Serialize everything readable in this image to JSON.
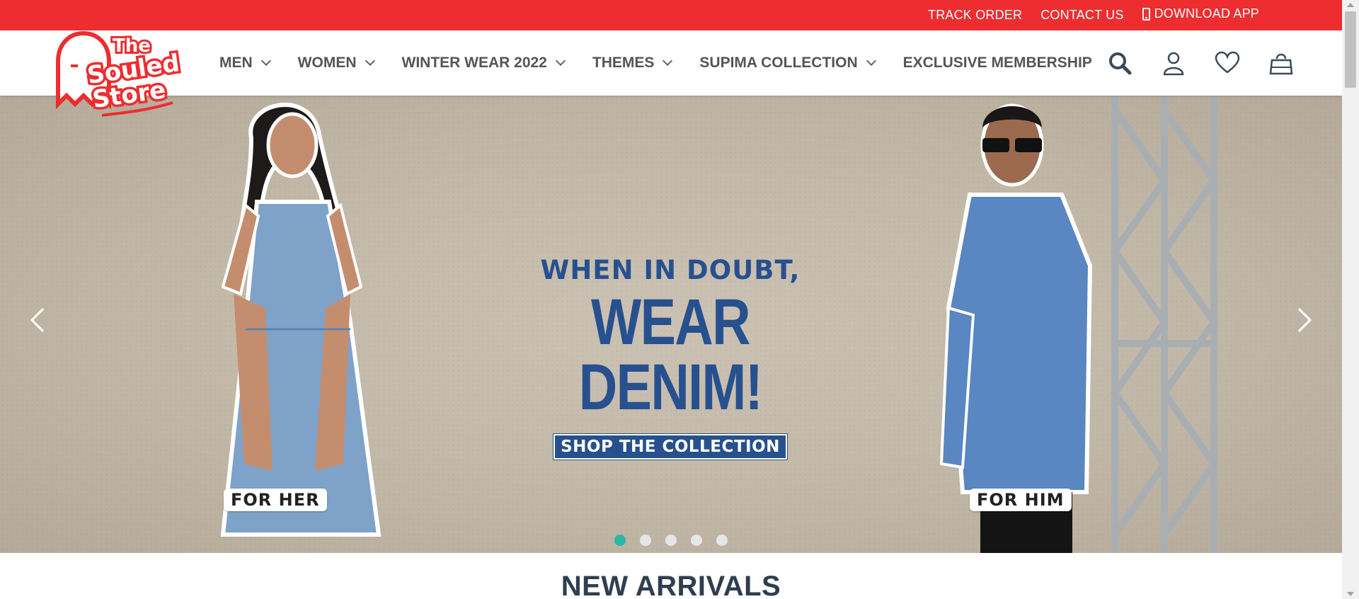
{
  "topbar": {
    "bg_color": "#ed2d2f",
    "links": [
      {
        "label": "TRACK ORDER"
      },
      {
        "label": "CONTACT US"
      },
      {
        "label": "DOWNLOAD APP",
        "icon": "mobile-phone-icon"
      }
    ]
  },
  "header": {
    "logo": {
      "line1": "The",
      "line2": "Souled",
      "line3": "Store",
      "brand_color": "#ed2d2f"
    },
    "nav": [
      {
        "label": "MEN",
        "has_dropdown": true
      },
      {
        "label": "WOMEN",
        "has_dropdown": true
      },
      {
        "label": "WINTER WEAR 2022",
        "has_dropdown": true
      },
      {
        "label": "THEMES",
        "has_dropdown": true
      },
      {
        "label": "SUPIMA COLLECTION",
        "has_dropdown": true
      },
      {
        "label": "EXCLUSIVE MEMBERSHIP",
        "has_dropdown": false
      }
    ],
    "icons": [
      "search-icon",
      "user-icon",
      "heart-icon",
      "shopping-bag-icon"
    ]
  },
  "hero": {
    "line1": "WHEN IN DOUBT,",
    "line2": "WEAR DENIM!",
    "cta": "SHOP THE COLLECTION",
    "tag_left": "FOR HER",
    "tag_right": "FOR HIM",
    "text_color": "#27508e",
    "slides_total": 5,
    "active_slide": 1,
    "active_dot_color": "#28b6a6"
  },
  "section": {
    "title": "NEW ARRIVALS"
  }
}
